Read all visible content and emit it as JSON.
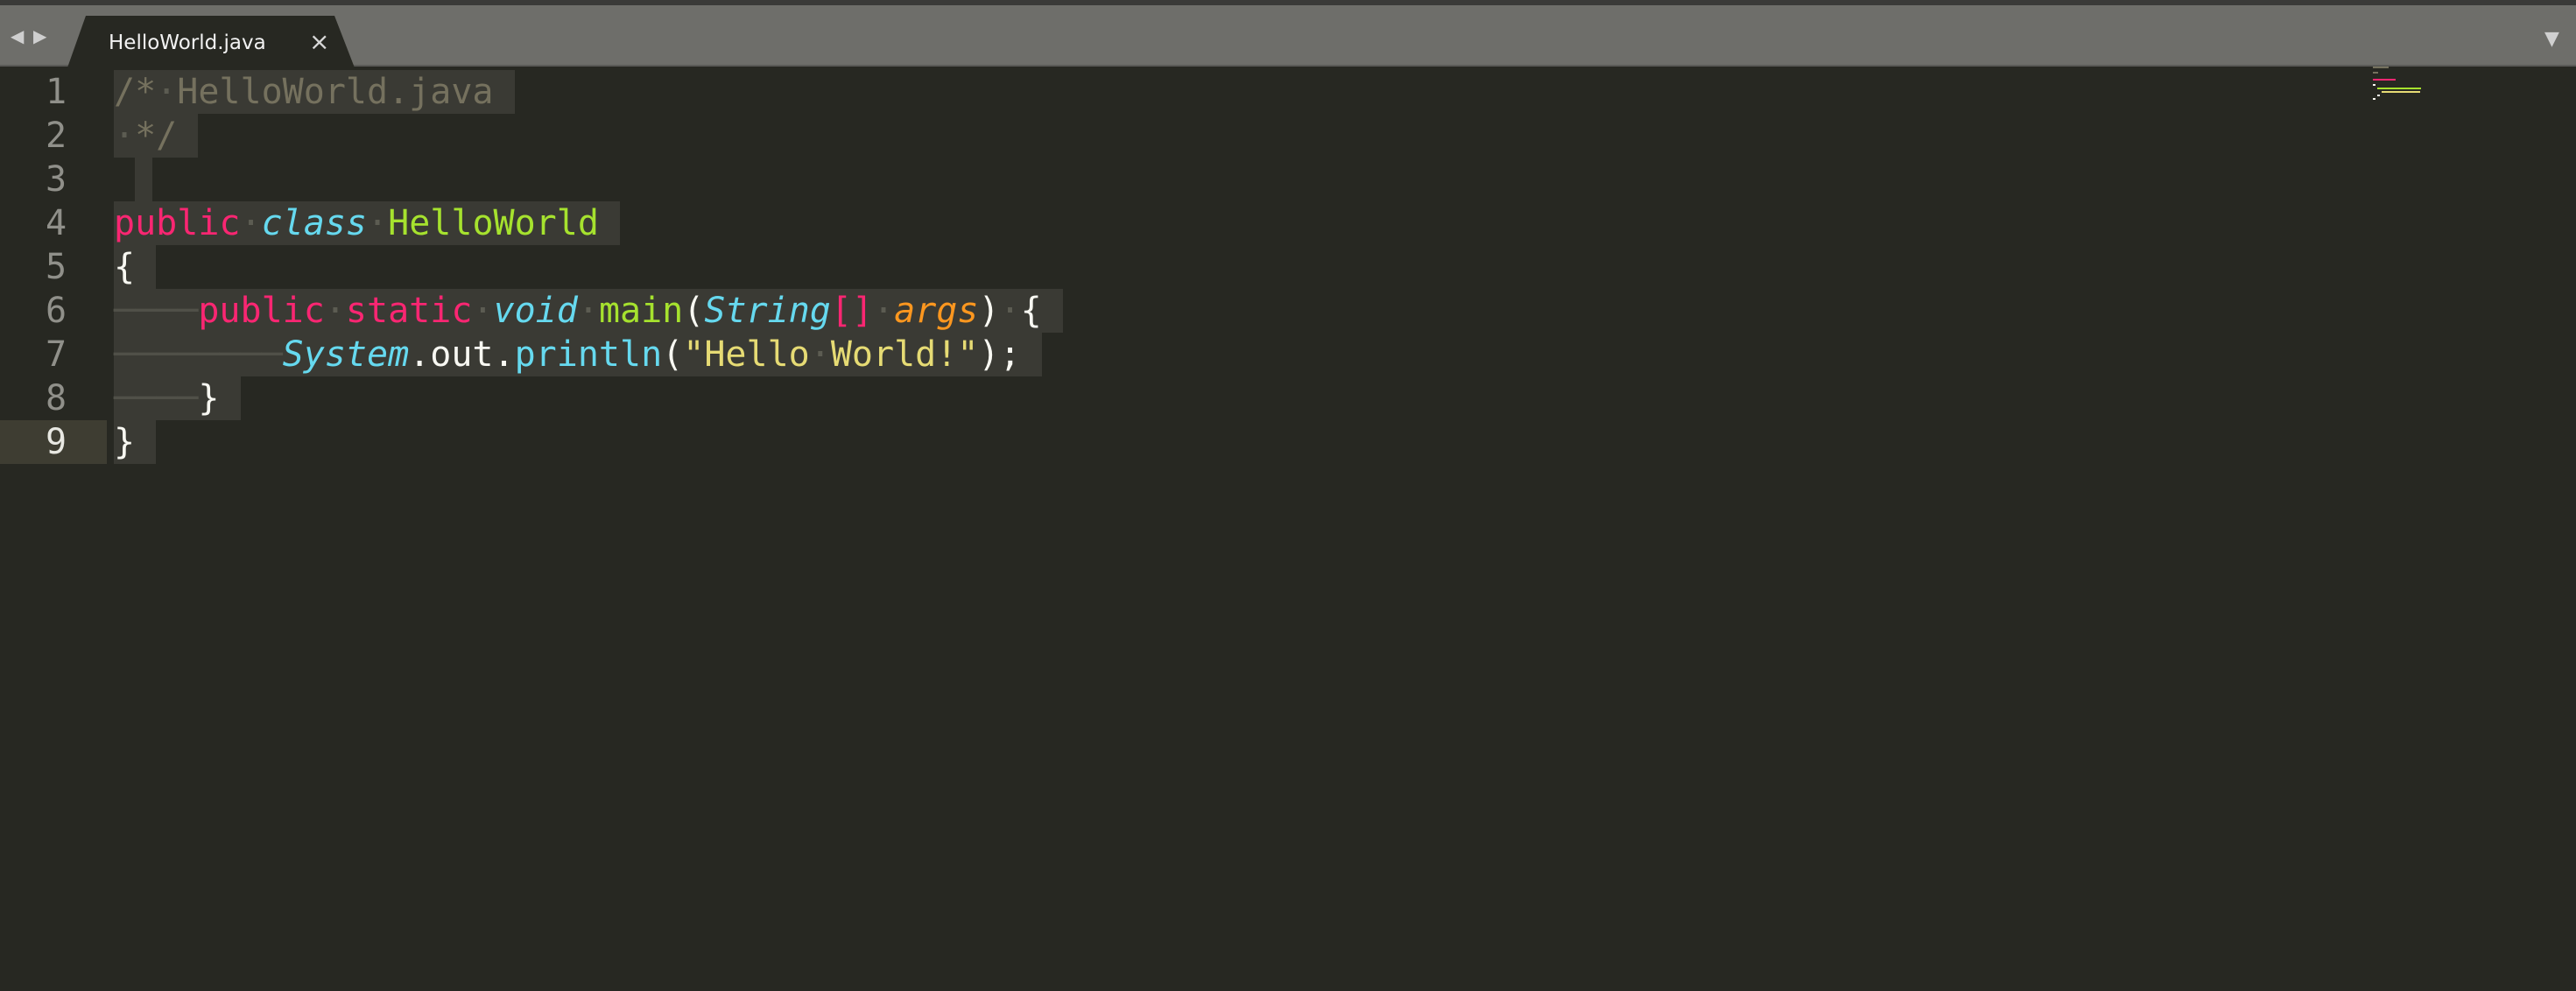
{
  "window": {
    "nav_back": "◀",
    "nav_forward": "▶",
    "dropdown": "▼"
  },
  "tab": {
    "title": "HelloWorld.java",
    "close": "×"
  },
  "editor": {
    "active_line": 9,
    "line_numbers": [
      "1",
      "2",
      "3",
      "4",
      "5",
      "6",
      "7",
      "8",
      "9"
    ],
    "lines": [
      {
        "tokens": [
          {
            "t": "/*",
            "c": "cm"
          },
          {
            "t": "·",
            "c": "ws"
          },
          {
            "t": "HelloWorld.java",
            "c": "cm"
          }
        ]
      },
      {
        "tokens": [
          {
            "t": "·",
            "c": "ws"
          },
          {
            "t": "*/",
            "c": "cm"
          }
        ]
      },
      {
        "tokens": []
      },
      {
        "tokens": [
          {
            "t": "public",
            "c": "kw"
          },
          {
            "t": "·",
            "c": "ws"
          },
          {
            "t": "class",
            "c": "st"
          },
          {
            "t": "·",
            "c": "ws"
          },
          {
            "t": "HelloWorld",
            "c": "cn"
          }
        ]
      },
      {
        "tokens": [
          {
            "t": "{",
            "c": "pl"
          }
        ]
      },
      {
        "tokens": [
          {
            "t": "────",
            "c": "guide"
          },
          {
            "t": "public",
            "c": "kw"
          },
          {
            "t": "·",
            "c": "ws"
          },
          {
            "t": "static",
            "c": "kw"
          },
          {
            "t": "·",
            "c": "ws"
          },
          {
            "t": "void",
            "c": "st"
          },
          {
            "t": "·",
            "c": "ws"
          },
          {
            "t": "main",
            "c": "fn"
          },
          {
            "t": "(",
            "c": "pl"
          },
          {
            "t": "String",
            "c": "ty"
          },
          {
            "t": "[]",
            "c": "br"
          },
          {
            "t": "·",
            "c": "ws"
          },
          {
            "t": "args",
            "c": "ar"
          },
          {
            "t": ")",
            "c": "pl"
          },
          {
            "t": "·",
            "c": "ws"
          },
          {
            "t": "{",
            "c": "pl"
          }
        ]
      },
      {
        "tokens": [
          {
            "t": "────────",
            "c": "guide"
          },
          {
            "t": "System",
            "c": "ty"
          },
          {
            "t": ".out.",
            "c": "pl"
          },
          {
            "t": "println",
            "c": "call"
          },
          {
            "t": "(",
            "c": "pl"
          },
          {
            "t": "\"Hello",
            "c": "str"
          },
          {
            "t": "·",
            "c": "ws"
          },
          {
            "t": "World!\"",
            "c": "str"
          },
          {
            "t": ");",
            "c": "pl"
          }
        ]
      },
      {
        "tokens": [
          {
            "t": "────",
            "c": "guide"
          },
          {
            "t": "}",
            "c": "pl"
          }
        ]
      },
      {
        "tokens": [
          {
            "t": "}",
            "c": "pl"
          }
        ]
      }
    ]
  }
}
